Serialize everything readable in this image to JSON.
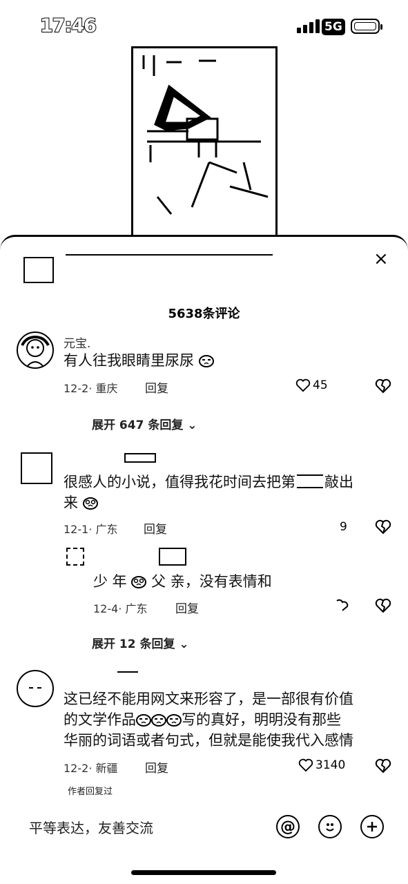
{
  "status_bar": {
    "time": "17:46",
    "network": "5G"
  },
  "comments_header": {
    "count_text": "5638条评论",
    "close_label": "×"
  },
  "comments": [
    {
      "username": "元宝.",
      "text": "有人往我眼睛里尿尿",
      "date": "12-2",
      "location": "重庆",
      "reply_label": "回复",
      "likes": "45",
      "expand_label": "展开 647 条回复"
    },
    {
      "text_line1": "很感人的小说，值得我花时间去把第",
      "text_line1_end": "敲出",
      "text_line2": "来",
      "date": "12-1",
      "location": "广东",
      "reply_label": "回复",
      "likes": "9",
      "sub_reply": {
        "text_a": "少 年",
        "text_b": "父 亲，没有表情和",
        "date": "12-4",
        "location": "广东",
        "reply_label": "回复"
      },
      "expand_label": "展开 12 条回复"
    },
    {
      "text_line1": "这已经不能用网文来形容了，是一部很有价值",
      "text_line2": "的文学作品",
      "text_line2_end": "写的真好，明明没有那些",
      "text_line3": "华丽的词语或者句式，但就是能使我代入感情",
      "date": "12-2",
      "location": "新疆",
      "reply_label": "回复",
      "likes": "3140",
      "author_badge": "作者回复过"
    }
  ],
  "input_bar": {
    "placeholder": "平等表达，友善交流",
    "mention_icon": "@"
  }
}
